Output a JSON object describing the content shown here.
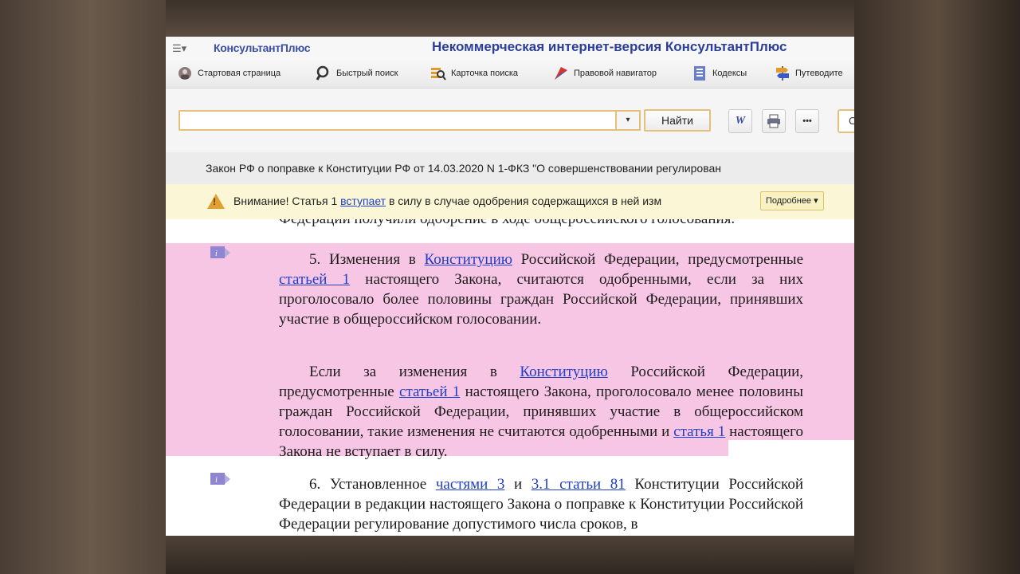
{
  "app": {
    "brand": "КонсультантПлюс",
    "title": "Некоммерческая интернет-версия КонсультантПлюс",
    "menu_icon": "menu-icon"
  },
  "toolbar": {
    "items": [
      {
        "label": "Стартовая страница",
        "icon": "home-icon"
      },
      {
        "label": "Быстрый поиск",
        "icon": "search-icon"
      },
      {
        "label": "Карточка поиска",
        "icon": "search-card-icon"
      },
      {
        "label": "Правовой навигатор",
        "icon": "navigator-icon"
      },
      {
        "label": "Кодексы",
        "icon": "codes-icon"
      },
      {
        "label": "Путеводите",
        "icon": "guide-icon"
      }
    ]
  },
  "search": {
    "value": "",
    "placeholder": "",
    "dropdown_glyph": "▾",
    "find_label": "Найти",
    "word_label": "W",
    "more_label": "•••",
    "edge_label": "С"
  },
  "document": {
    "title": "Закон РФ о поправке к Конституции РФ от 14.03.2020 N 1-ФКЗ \"О совершенствовании регулирован"
  },
  "warning": {
    "prefix": "Внимание! Статья 1 ",
    "link": "вступает",
    "suffix": " в силу в случае одобрения содержащихся в ней изм",
    "more_label": "Подробнее ▾"
  },
  "content": {
    "cut_line": "Федерации получили одобрение в ходе общероссийского голосования.",
    "p5": {
      "a": "5. Изменения в ",
      "link1": "Конституцию",
      "b": " Российской Федерации, предусмотренные ",
      "link2": "статьей 1",
      "c": " настоящего Закона, считаются одобренными, если за них проголосовало более половины граждан Российской Федерации, принявших участие в общероссийском голосовании."
    },
    "p5b": {
      "a": "Если за изменения в ",
      "link1": "Конституцию",
      "b": " Российской Федерации, предусмотренные ",
      "link2": "статьей 1",
      "c": " настоящего Закона, проголосовало менее половины граждан Российской Федерации, принявших участие в общероссийском голосовании, такие изменения не считаются одобренными и ",
      "link3": "статья 1",
      "d": " настоящего Закона не вступает в силу."
    },
    "p6": {
      "a": "6. Установленное ",
      "link1": "частями 3",
      "b": " и ",
      "link2": "3.1 статьи 81",
      "c": " Конституции Российской Федерации в редакции настоящего Закона о поправке к Конституции Российской Федерации регулирование допустимого числа сроков, в"
    }
  },
  "colors": {
    "highlight": "#f7c6e4",
    "link": "#1f3fc9",
    "accent_border": "#e6bf7a",
    "warning_bg": "#fbf7d6"
  }
}
